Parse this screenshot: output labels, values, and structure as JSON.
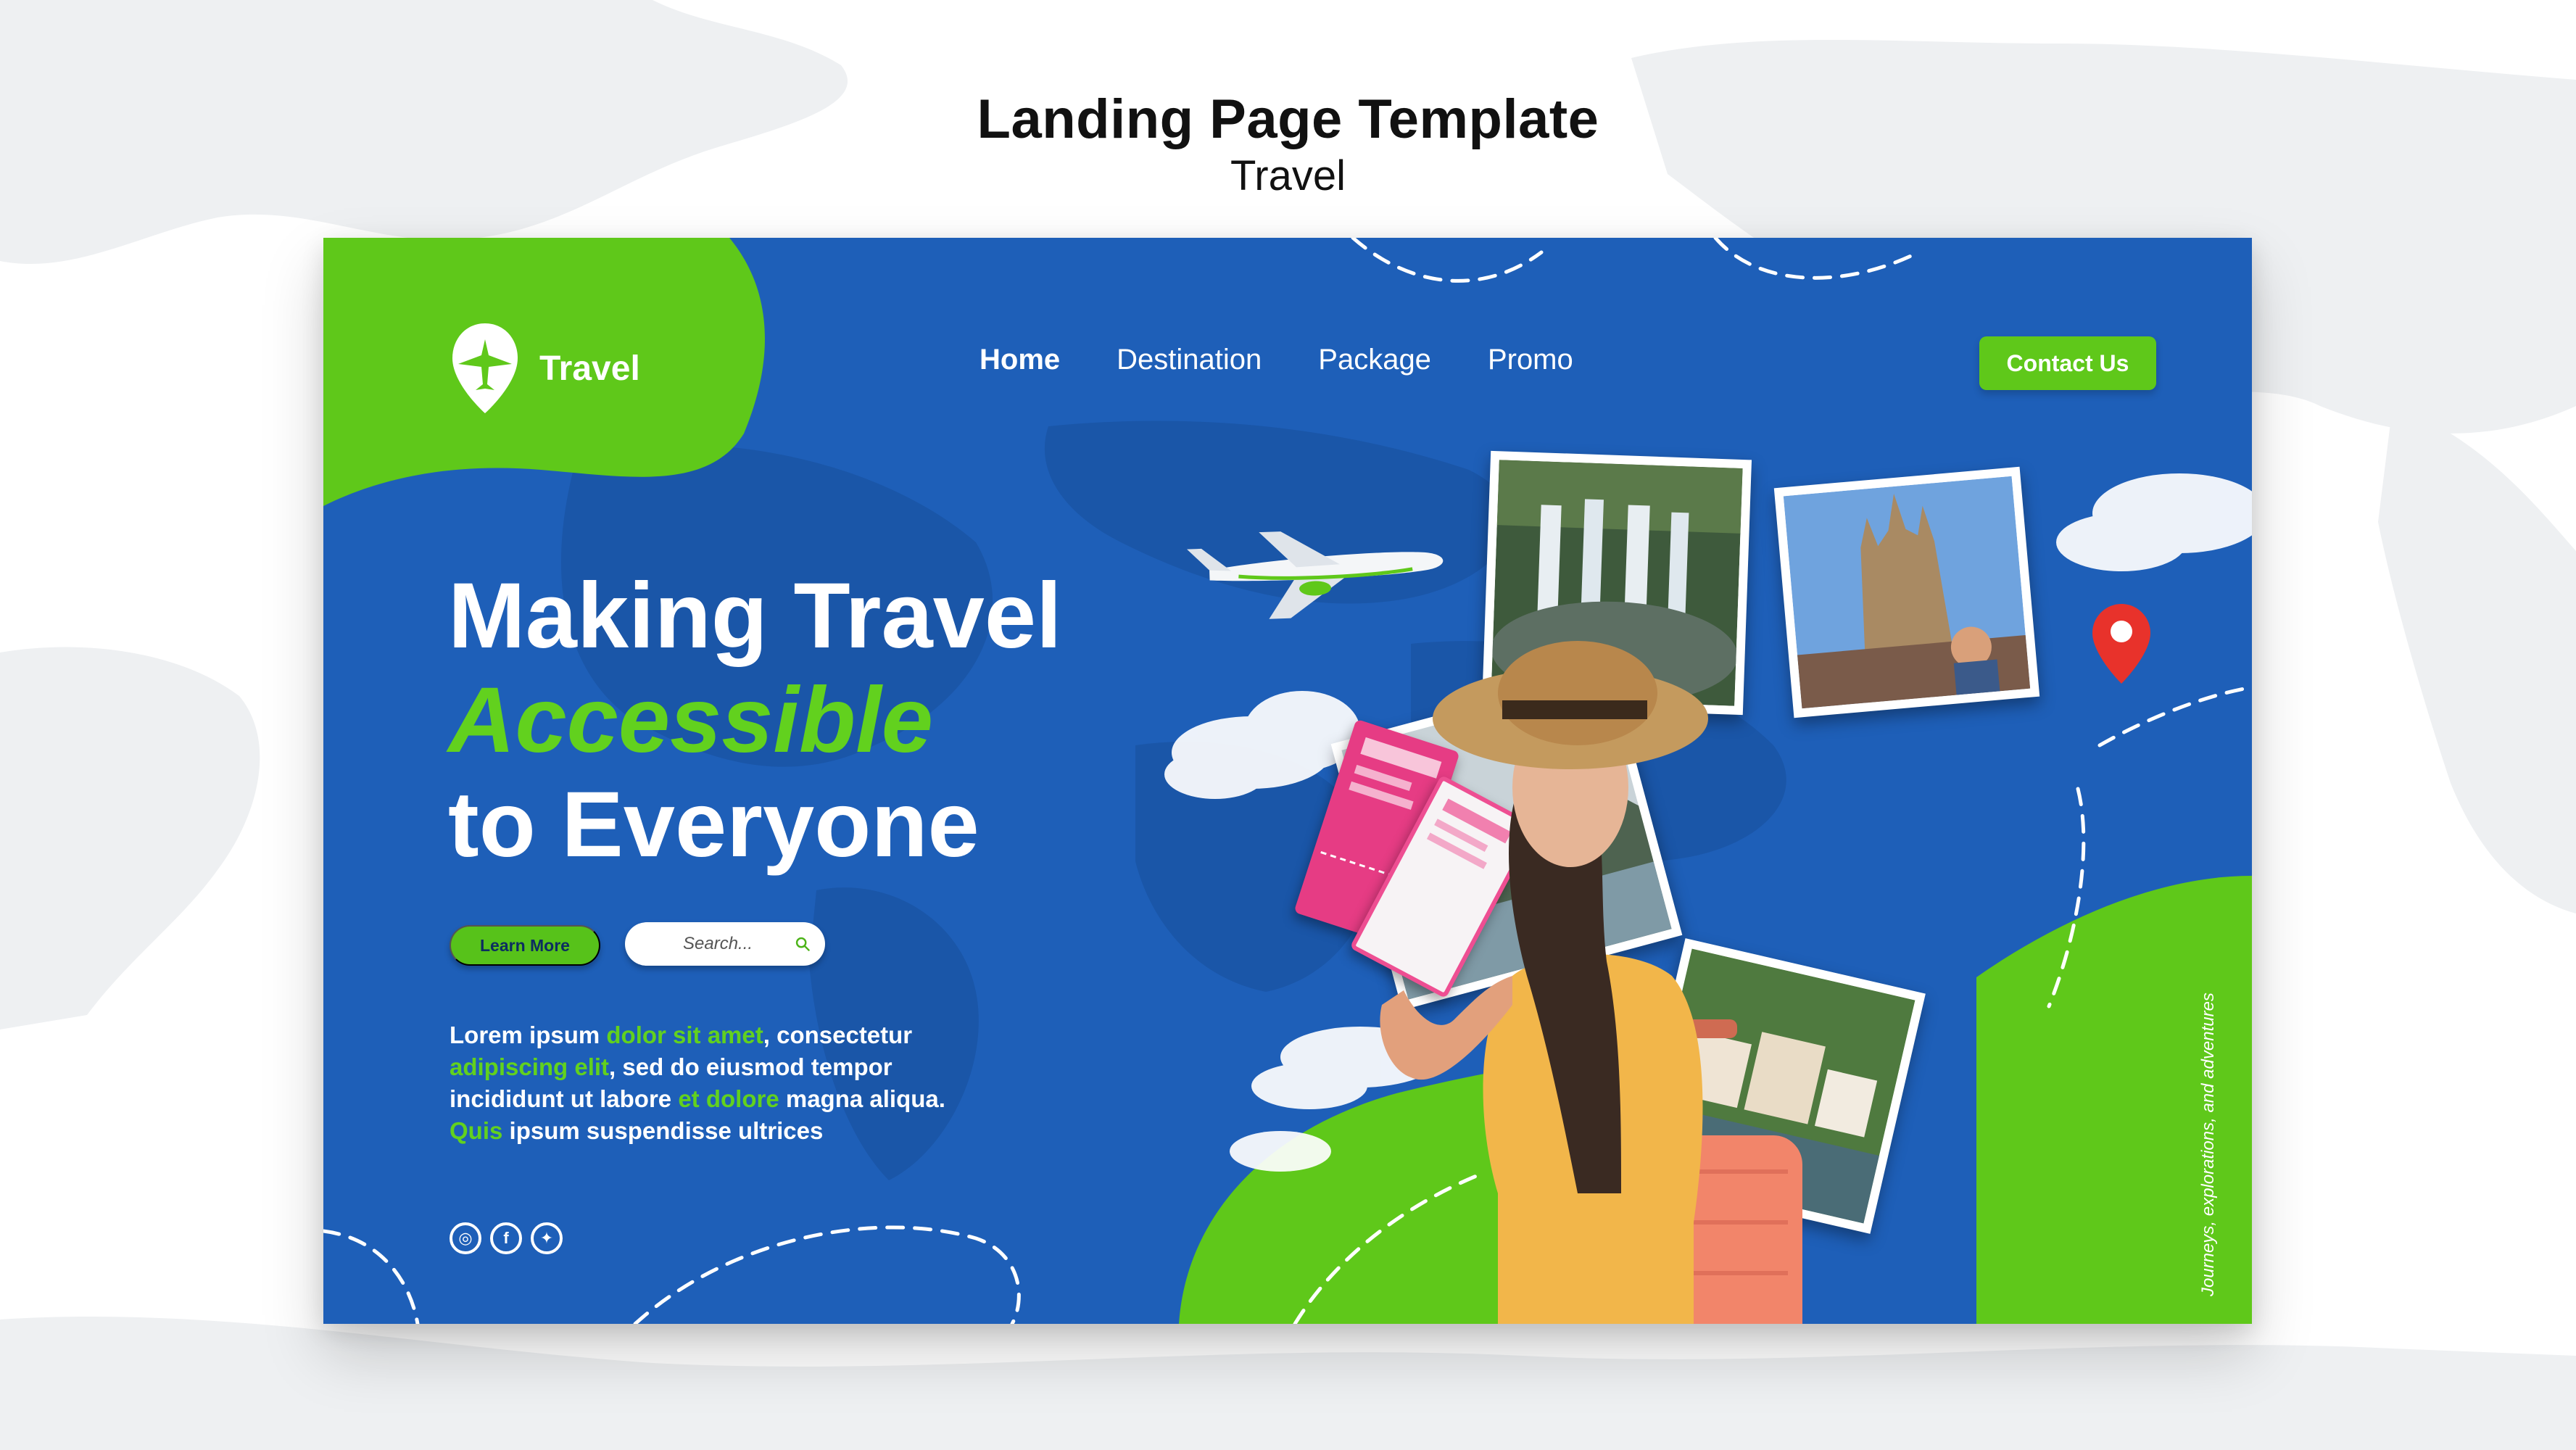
{
  "heading": {
    "title": "Landing Page Template",
    "subtitle": "Travel"
  },
  "brand": {
    "name": "Travel",
    "logo_icon": "airplane-pin-icon"
  },
  "nav": {
    "items": [
      {
        "label": "Home",
        "active": true
      },
      {
        "label": "Destination",
        "active": false
      },
      {
        "label": "Package",
        "active": false
      },
      {
        "label": "Promo",
        "active": false
      }
    ],
    "contact_label": "Contact Us"
  },
  "hero": {
    "line1": "Making Travel",
    "line2": "Accessible",
    "line3": "to Everyone"
  },
  "actions": {
    "learn_more_label": "Learn More",
    "search_placeholder": "Search..."
  },
  "body": {
    "t1": "Lorem ipsum ",
    "h1": "dolor sit amet",
    "t2": ", consectetur",
    "h2": "adipiscing elit",
    "t3": ", sed do eiusmod tempor incididunt ut labore ",
    "h3": "et dolore",
    "t4": " magna aliqua. ",
    "h4": "Quis",
    "t5": " ipsum suspendisse ultrices"
  },
  "socials": [
    {
      "name": "instagram-icon",
      "glyph": "◎"
    },
    {
      "name": "facebook-icon",
      "glyph": "f"
    },
    {
      "name": "twitter-icon",
      "glyph": "✦"
    }
  ],
  "tagline": "Journeys, explorations, and adventures",
  "colors": {
    "blue": "#1e5fb8",
    "green": "#5fc81a",
    "accent_text": "#62d11e",
    "pin_red": "#e8322b"
  }
}
